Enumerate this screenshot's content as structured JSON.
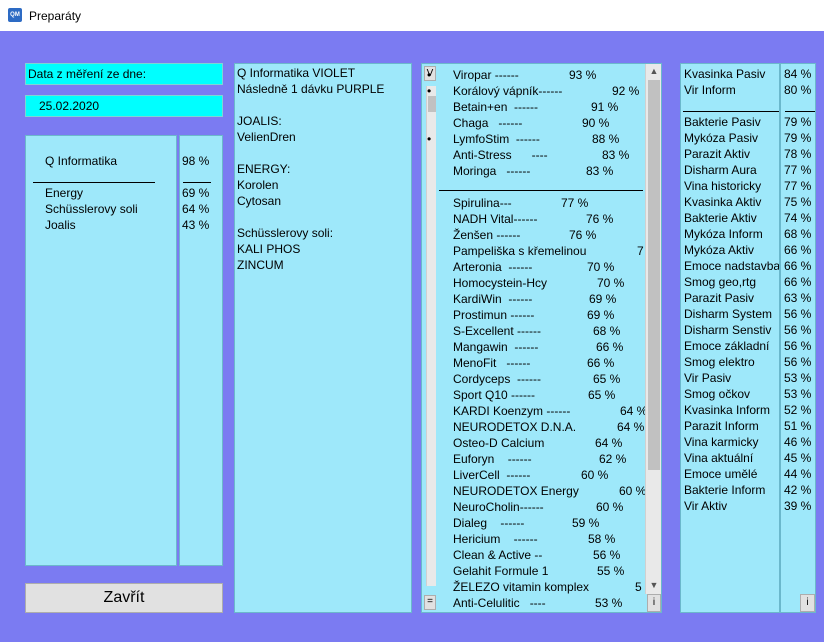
{
  "window": {
    "title": "Preparáty",
    "icon_text": "QM"
  },
  "date_label": "Data z měření ze dne:",
  "date_value": "25.02.2020",
  "summary": {
    "top": {
      "label": "Q Informatika",
      "value": "98 %"
    },
    "items": [
      {
        "label": "Energy",
        "value": "69 %"
      },
      {
        "label": "Schüsslerovy soli",
        "value": "64 %"
      },
      {
        "label": "Joalis",
        "value": "43 %"
      }
    ]
  },
  "prescription_lines": [
    "Q Informatika  VIOLET",
    "Následně 1 dávku PURPLE",
    "",
    "JOALIS:",
    "VelienDren",
    "",
    "ENERGY:",
    "Korolen",
    "Cytosan",
    "",
    "Schüsslerovy soli:",
    "KALI PHOS",
    "ZINCUM"
  ],
  "preparations_left": {
    "top_button": "V",
    "bottom_button": "=",
    "info_button": "i",
    "top_items": [
      {
        "bullet": "•",
        "label": "Viropar ------",
        "value": "93 %"
      },
      {
        "bullet": "•",
        "label": "Korálový vápník------",
        "value": "92 %"
      },
      {
        "bullet": "",
        "label": "Betain+en  ------",
        "value": "91 %"
      },
      {
        "bullet": "",
        "label": "Chaga   ------",
        "value": "90 %"
      },
      {
        "bullet": "•",
        "label": "LymfoStim  ------",
        "value": "88 %"
      },
      {
        "bullet": "",
        "label": "Anti-Stress      ----",
        "value": "83 %"
      },
      {
        "bullet": "",
        "label": "Moringa   ------",
        "value": "83 %"
      }
    ],
    "items": [
      {
        "label": "Spirulina---",
        "value": "77 %"
      },
      {
        "label": "NADH Vital------",
        "value": "76 %"
      },
      {
        "label": "Ženšen ------",
        "value": "76 %"
      },
      {
        "label": "Pampeliška s křemelinou",
        "value": "7"
      },
      {
        "label": "Arteronia  ------",
        "value": "70 %"
      },
      {
        "label": "Homocystein-Hcy",
        "value": "70 %"
      },
      {
        "label": "KardiWin  ------",
        "value": "69 %"
      },
      {
        "label": "Prostimun ------",
        "value": "69 %"
      },
      {
        "label": "S-Excellent ------",
        "value": "68 %"
      },
      {
        "label": "Mangawin  ------",
        "value": "66 %"
      },
      {
        "label": "MenoFit   ------",
        "value": "66 %"
      },
      {
        "label": "Cordyceps  ------",
        "value": "65 %"
      },
      {
        "label": "Sport Q10 ------",
        "value": "65 %"
      },
      {
        "label": "KARDI Koenzym ------",
        "value": "64 %"
      },
      {
        "label": "NEURODETOX D.N.A.",
        "value": "64 %"
      },
      {
        "label": "Osteo-D Calcium",
        "value": "64 %"
      },
      {
        "label": "Euforyn    ------",
        "value": "62 %"
      },
      {
        "label": "LiverCell  ------",
        "value": "60 %"
      },
      {
        "label": "NEURODETOX Energy",
        "value": "60 %"
      },
      {
        "label": "NeuroCholin------",
        "value": "60 %"
      },
      {
        "label": "Dialeg    ------",
        "value": "59 %"
      },
      {
        "label": "Hericium    ------",
        "value": "58 %"
      },
      {
        "label": "Clean & Active --",
        "value": "56 %"
      },
      {
        "label": "Gelahit Formule 1",
        "value": "55 %"
      },
      {
        "label": "ŽELEZO vitamin komplex",
        "value": "5"
      },
      {
        "label": "Anti-Celulitic   ----",
        "value": "53 %"
      }
    ]
  },
  "preparations_right": {
    "info_button": "i",
    "top_items": [
      {
        "label": "Kvasinka Pasiv",
        "value": "84 %"
      },
      {
        "label": "Vir Inform",
        "value": "80 %"
      }
    ],
    "items": [
      {
        "label": "Bakterie Pasiv",
        "value": "79 %"
      },
      {
        "label": "Mykóza Pasiv",
        "value": "79 %"
      },
      {
        "label": "Parazit Aktiv",
        "value": "78 %"
      },
      {
        "label": "Disharm Aura",
        "value": "77 %"
      },
      {
        "label": "Vina historicky",
        "value": "77 %"
      },
      {
        "label": "Kvasinka Aktiv",
        "value": "75 %"
      },
      {
        "label": "Bakterie Aktiv",
        "value": "74 %"
      },
      {
        "label": "Mykóza Inform",
        "value": "68 %"
      },
      {
        "label": "Mykóza Aktiv",
        "value": "66 %"
      },
      {
        "label": "Emoce nadstavba",
        "value": "66 %"
      },
      {
        "label": "Smog geo,rtg",
        "value": "66 %"
      },
      {
        "label": "Parazit Pasiv",
        "value": "63 %"
      },
      {
        "label": "Disharm System",
        "value": "56 %"
      },
      {
        "label": "Disharm Senstiv",
        "value": "56 %"
      },
      {
        "label": "Emoce základní",
        "value": "56 %"
      },
      {
        "label": "Smog elektro",
        "value": "56 %"
      },
      {
        "label": "Vir Pasiv",
        "value": "53 %"
      },
      {
        "label": "Smog očkov",
        "value": "53 %"
      },
      {
        "label": "Kvasinka Inform",
        "value": "52 %"
      },
      {
        "label": "Parazit Inform",
        "value": "51 %"
      },
      {
        "label": "Vina karmicky",
        "value": "46 %"
      },
      {
        "label": "Vina aktuální",
        "value": "45 %"
      },
      {
        "label": "Emoce umělé",
        "value": "44 %"
      },
      {
        "label": "Bakterie Inform",
        "value": "42 %"
      },
      {
        "label": "Vir Aktiv",
        "value": "39 %"
      }
    ]
  },
  "close_button": "Zavřít"
}
